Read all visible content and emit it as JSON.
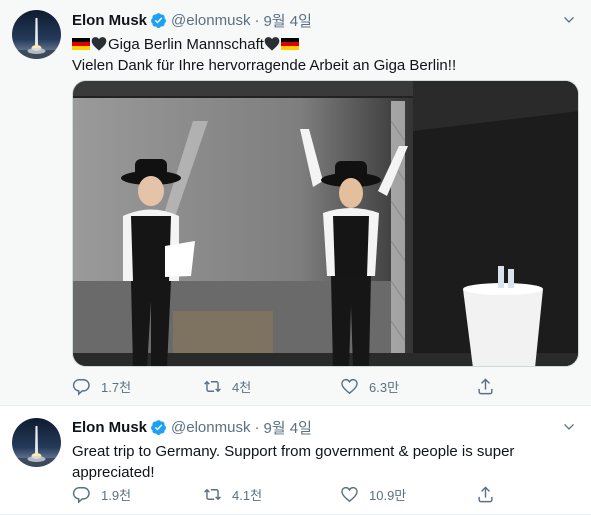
{
  "tweets": [
    {
      "author": {
        "name": "Elon Musk",
        "handle": "@elonmusk"
      },
      "dot": "·",
      "date": "9월 4일",
      "line1_text": "Giga Berlin Mannschaft",
      "line2": "Vielen Dank für Ihre hervorragende Arbeit an Giga Berlin!!",
      "stats": {
        "replies": "1.7천",
        "retweets": "4천",
        "likes": "6.3만"
      }
    },
    {
      "author": {
        "name": "Elon Musk",
        "handle": "@elonmusk"
      },
      "dot": "·",
      "date": "9월 4일",
      "line1": "Great trip to Germany. Support from government & people is super",
      "line2": "appreciated!",
      "stats": {
        "replies": "1.9천",
        "retweets": "4.1천",
        "likes": "10.9만"
      }
    }
  ],
  "colors": {
    "verified": "#1da1f2",
    "secondary_text": "#5b7083",
    "flag": [
      "#000000",
      "#dd0000",
      "#ffce00"
    ]
  },
  "icons": [
    "verified-badge-icon",
    "caret-down-icon",
    "reply-icon",
    "retweet-icon",
    "like-icon",
    "share-icon",
    "black-heart-icon",
    "german-flag-icon"
  ]
}
